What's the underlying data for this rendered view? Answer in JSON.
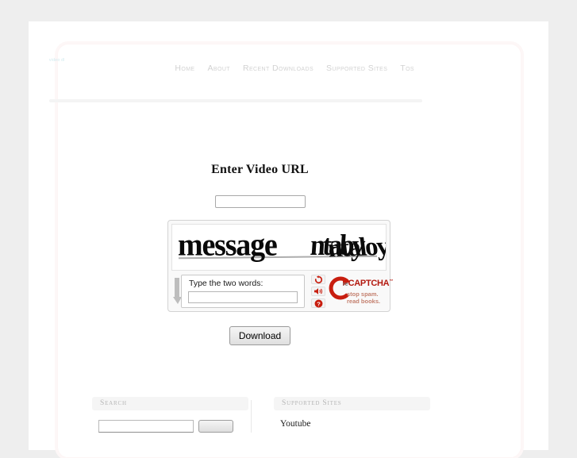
{
  "site": {
    "logo_text": "video dl"
  },
  "nav": {
    "items": [
      {
        "label": "Home"
      },
      {
        "label": "About"
      },
      {
        "label": "Recent Downloads"
      },
      {
        "label": "Supported Sites"
      },
      {
        "label": "Tos"
      }
    ]
  },
  "form": {
    "title": "Enter Video URL",
    "url_value": "",
    "url_placeholder": "",
    "download_label": "Download"
  },
  "recaptcha": {
    "challenge_word_1": "message",
    "challenge_word_2": "ntaby",
    "challenge_word_2_overlay": "ntaloy",
    "entry_label": "Type the two words:",
    "entry_value": "",
    "entry_placeholder": "",
    "brand_re": "re",
    "brand_captcha": "CAPTCHA",
    "brand_tm": "™",
    "tagline_line_1": "stop spam.",
    "tagline_line_2": "read books.",
    "refresh_icon": "refresh-icon",
    "audio_icon": "audio-icon",
    "help_icon": "help-icon",
    "brand_color": "#b3190f",
    "tagline_color": "#c4806f"
  },
  "widgets": {
    "search": {
      "title": "Search",
      "input_value": "",
      "input_placeholder": "",
      "button_label": ""
    },
    "supported_sites": {
      "title": "Supported Sites",
      "items": [
        {
          "label": "Youtube"
        }
      ]
    }
  },
  "colors": {
    "page_background": "#eeeeee",
    "sheet_background": "#ffffff",
    "nav_text": "#d2d2d2",
    "widget_title_text": "#b6b6b6"
  }
}
